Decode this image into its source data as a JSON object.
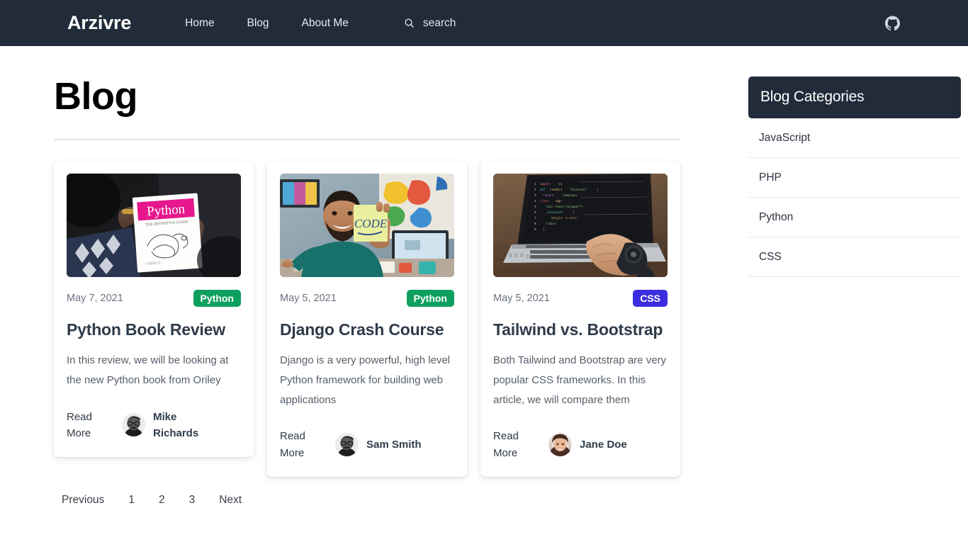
{
  "navbar": {
    "brand": "Arzivre",
    "links": [
      {
        "label": "Home"
      },
      {
        "label": "Blog"
      },
      {
        "label": "About Me"
      }
    ],
    "search": {
      "placeholder": "search",
      "value": "",
      "icon": "search-icon"
    },
    "right_icon": "github-icon",
    "background_color": "#212b3a"
  },
  "page": {
    "title": "Blog"
  },
  "posts": [
    {
      "image_alt": "hands-holding-python-oreilly-book",
      "date": "May 7, 2021",
      "category": "Python",
      "category_color": "#0ea05e",
      "title": "Python Book Review",
      "excerpt": "In this review, we will be looking at the new Python book from Oriley",
      "read_more": "Read More",
      "author": "Mike Richards",
      "avatar_alt": "avatar-mike-richards"
    },
    {
      "image_alt": "man-holding-code-sticky-note",
      "date": "May 5, 2021",
      "category": "Python",
      "category_color": "#0ea05e",
      "title": "Django Crash Course",
      "excerpt": "Django is a very powerful, high level Python framework for building web applications",
      "read_more": "Read More",
      "author": "Sam Smith",
      "avatar_alt": "avatar-sam-smith"
    },
    {
      "image_alt": "hand-typing-on-laptop-with-code",
      "date": "May 5, 2021",
      "category": "CSS",
      "category_color": "#3b2ee0",
      "title": "Tailwind vs. Bootstrap",
      "excerpt": "Both Tailwind and Bootstrap are very popular CSS frameworks. In this article, we will compare them",
      "read_more": "Read More",
      "author": "Jane Doe",
      "avatar_alt": "avatar-jane-doe"
    }
  ],
  "pagination": {
    "previous": "Previous",
    "pages": [
      "1",
      "2",
      "3"
    ],
    "next": "Next"
  },
  "sidebar": {
    "heading": "Blog Categories",
    "categories": [
      {
        "label": "JavaScript"
      },
      {
        "label": "PHP"
      },
      {
        "label": "Python"
      },
      {
        "label": "CSS"
      }
    ]
  }
}
